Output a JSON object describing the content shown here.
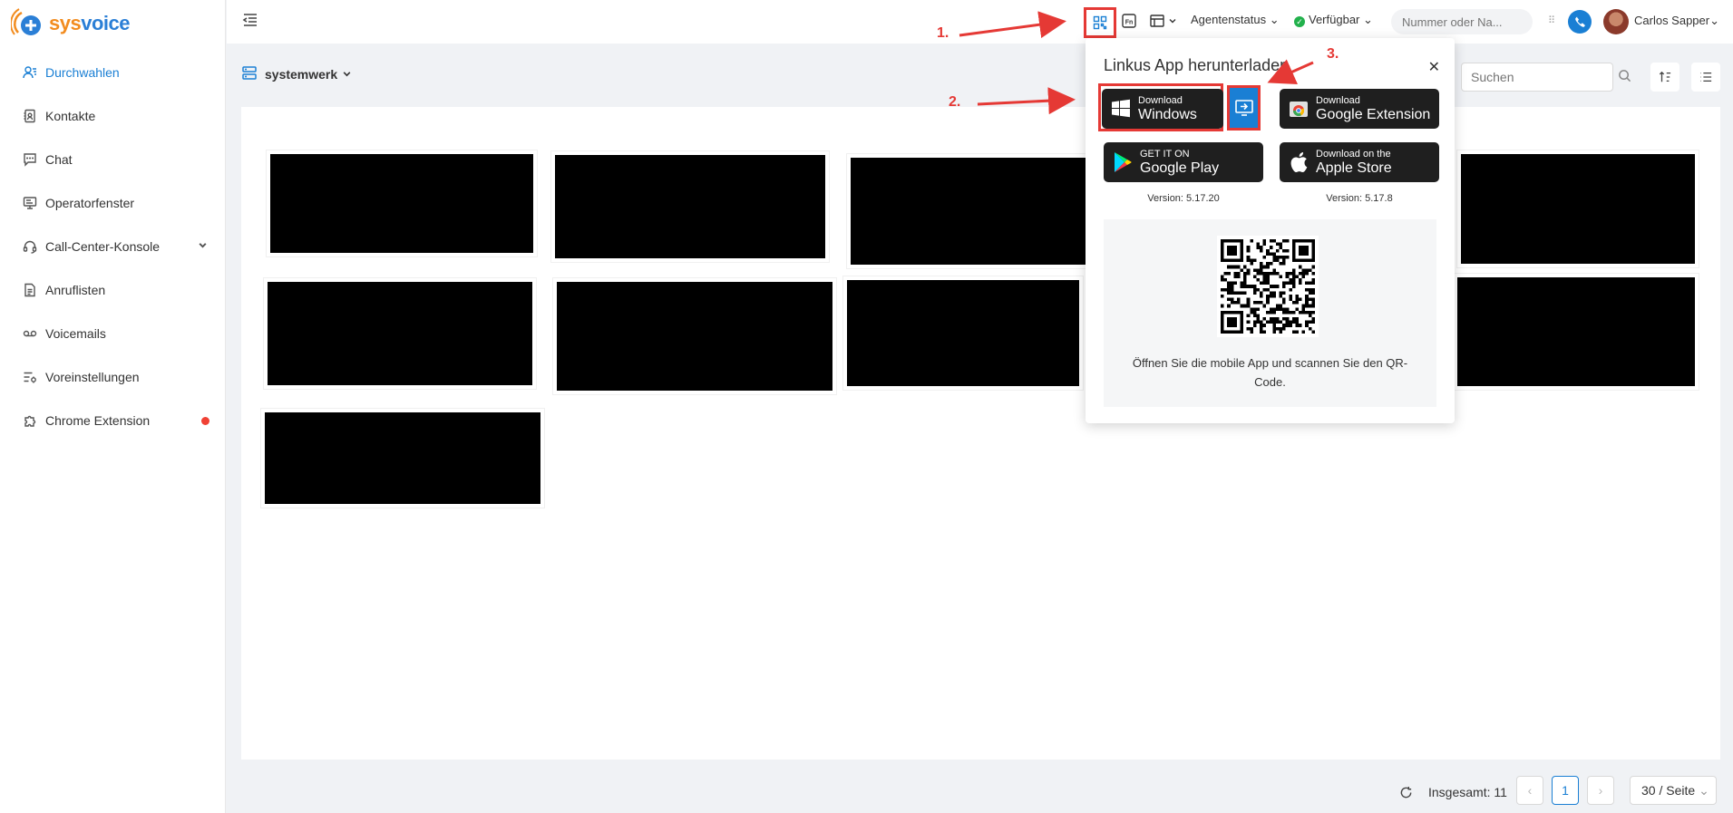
{
  "app": {
    "logo_text_orange": "sys",
    "logo_text_blue": "voice"
  },
  "sidebar": {
    "items": [
      {
        "label": "Durchwahlen",
        "icon": "user-list-icon",
        "active": true
      },
      {
        "label": "Kontakte",
        "icon": "contact-book-icon"
      },
      {
        "label": "Chat",
        "icon": "chat-bubble-icon"
      },
      {
        "label": "Operatorfenster",
        "icon": "monitor-icon"
      },
      {
        "label": "Call-Center-Konsole",
        "icon": "headset-icon",
        "expandable": true
      },
      {
        "label": "Anruflisten",
        "icon": "call-log-icon"
      },
      {
        "label": "Voicemails",
        "icon": "voicemail-icon"
      },
      {
        "label": "Voreinstellungen",
        "icon": "preferences-icon"
      },
      {
        "label": "Chrome Extension",
        "icon": "puzzle-icon",
        "badge_dot": true
      }
    ]
  },
  "header": {
    "agent_status_label": "Agentenstatus",
    "availability_label": "Verfügbar",
    "dial_placeholder": "Nummer oder Na...",
    "user_name": "Carlos Sapper"
  },
  "toolbar": {
    "server_label": "systemwerk",
    "search_placeholder": "Suchen"
  },
  "pagination": {
    "total_label": "Insgesamt: 11",
    "current_page": "1",
    "per_page": "30 / Seite"
  },
  "popup": {
    "title": "Linkus App herunterladen",
    "windows": {
      "small": "Download",
      "big": "Windows"
    },
    "chrome": {
      "small": "Download",
      "big": "Google Extension"
    },
    "google_play": {
      "small": "GET IT ON",
      "big": "Google Play"
    },
    "apple": {
      "small": "Download on the",
      "big": "Apple Store"
    },
    "version_android": "Version: 5.17.20",
    "version_ios": "Version: 5.17.8",
    "qr_hint": "Öffnen Sie die mobile App und scannen Sie den QR-Code."
  },
  "annotations": {
    "step1": "1.",
    "step2": "2.",
    "step3": "3."
  },
  "colors": {
    "accent": "#1a7fd4",
    "annotation_red": "#e53935",
    "status_green": "#22b14c",
    "badge_red": "#f04134"
  }
}
